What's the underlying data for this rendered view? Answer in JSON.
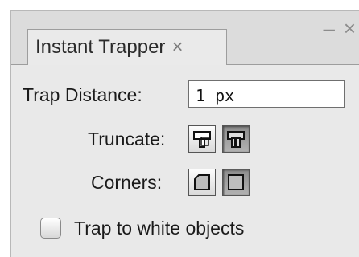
{
  "panel": {
    "tab_title": "Instant Trapper",
    "tab_close_glyph": "×",
    "minimize_glyph": "–",
    "close_glyph": "×"
  },
  "trap_distance": {
    "label": "Trap Distance:",
    "value": "1 px"
  },
  "truncate": {
    "label": "Truncate:",
    "buttons": [
      {
        "icon": "truncate-icon-a",
        "selected": false
      },
      {
        "icon": "truncate-icon-b",
        "selected": true
      }
    ]
  },
  "corners": {
    "label": "Corners:",
    "buttons": [
      {
        "icon": "corners-beveled-icon",
        "selected": false
      },
      {
        "icon": "corners-square-icon",
        "selected": true
      }
    ]
  },
  "trap_white": {
    "label": "Trap to white objects",
    "checked": false
  }
}
